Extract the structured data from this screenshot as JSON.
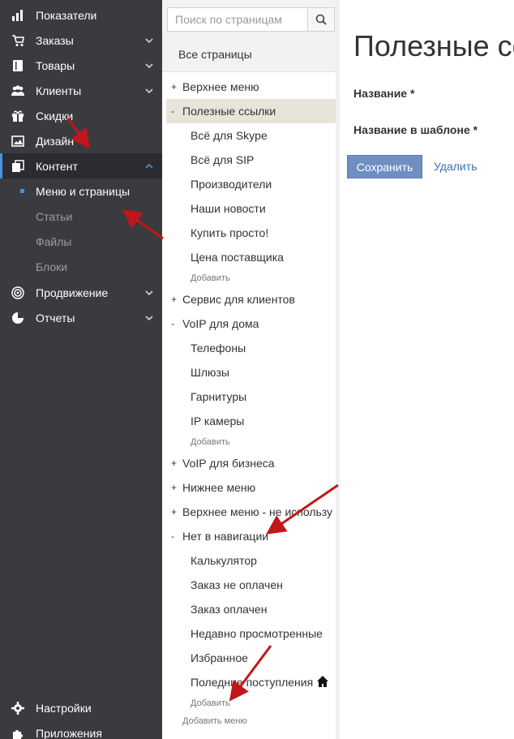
{
  "sidebar": {
    "items": [
      {
        "label": "Показатели",
        "icon": "bar-chart-icon",
        "chevron": false
      },
      {
        "label": "Заказы",
        "icon": "cart-icon",
        "chevron": true
      },
      {
        "label": "Товары",
        "icon": "book-icon",
        "chevron": true
      },
      {
        "label": "Клиенты",
        "icon": "users-icon",
        "chevron": true
      },
      {
        "label": "Скидки",
        "icon": "gift-icon",
        "chevron": false
      },
      {
        "label": "Дизайн",
        "icon": "image-icon",
        "chevron": false
      },
      {
        "label": "Контент",
        "icon": "copy-icon",
        "chevron": true,
        "active": true
      }
    ],
    "sub_items": [
      {
        "label": "Меню и страницы",
        "current": true
      },
      {
        "label": "Статьи"
      },
      {
        "label": "Файлы"
      },
      {
        "label": "Блоки"
      }
    ],
    "items2": [
      {
        "label": "Продвижение",
        "icon": "target-icon",
        "chevron": true
      },
      {
        "label": "Отчеты",
        "icon": "pie-chart-icon",
        "chevron": true
      }
    ],
    "bottom": [
      {
        "label": "Настройки",
        "icon": "gear-icon"
      },
      {
        "label": "Приложения",
        "icon": "puzzle-icon"
      }
    ]
  },
  "panel": {
    "search_placeholder": "Поиск по страницам",
    "all_pages": "Все страницы",
    "tree": [
      {
        "sign": "+",
        "label": "Верхнее меню"
      },
      {
        "sign": "-",
        "label": "Полезные ссылки",
        "selected": true
      },
      {
        "child": "Всё для Skype"
      },
      {
        "child": "Всё для SIP"
      },
      {
        "child": "Производители"
      },
      {
        "child": "Наши новости"
      },
      {
        "child": "Купить просто!"
      },
      {
        "child": "Цена поставщика"
      },
      {
        "add": "Добавить"
      },
      {
        "sign": "+",
        "label": "Сервис для клиентов"
      },
      {
        "sign": "-",
        "label": "VoIP для дома"
      },
      {
        "child": "Телефоны"
      },
      {
        "child": "Шлюзы"
      },
      {
        "child": "Гарнитуры"
      },
      {
        "child": "IP камеры"
      },
      {
        "add": "Добавить"
      },
      {
        "sign": "+",
        "label": "VoIP для бизнеса"
      },
      {
        "sign": "+",
        "label": "Нижнее меню"
      },
      {
        "sign": "+",
        "label": "Верхнее меню - не использу"
      },
      {
        "sign": "-",
        "label": "Нет в навигации"
      },
      {
        "child": "Калькулятор"
      },
      {
        "child": "Заказ не оплачен"
      },
      {
        "child": "Заказ оплачен"
      },
      {
        "child": "Недавно просмотренные"
      },
      {
        "child": "Избранное"
      },
      {
        "child": "Поледние поступления",
        "home_icon": true
      },
      {
        "add": "Добавить"
      }
    ],
    "add_menu": "Добавить меню"
  },
  "content": {
    "title": "Полезные ссылки",
    "field_name": "Название *",
    "field_template_name": "Название в шаблоне *",
    "save": "Сохранить",
    "delete": "Удалить"
  },
  "colors": {
    "sidebar_bg": "#3a3b3f",
    "accent": "#4a90e2",
    "selected_row": "#e8e4da",
    "save_button": "#6f8fc2",
    "link": "#3b6fb6",
    "annotation_arrow": "#c0171a"
  }
}
